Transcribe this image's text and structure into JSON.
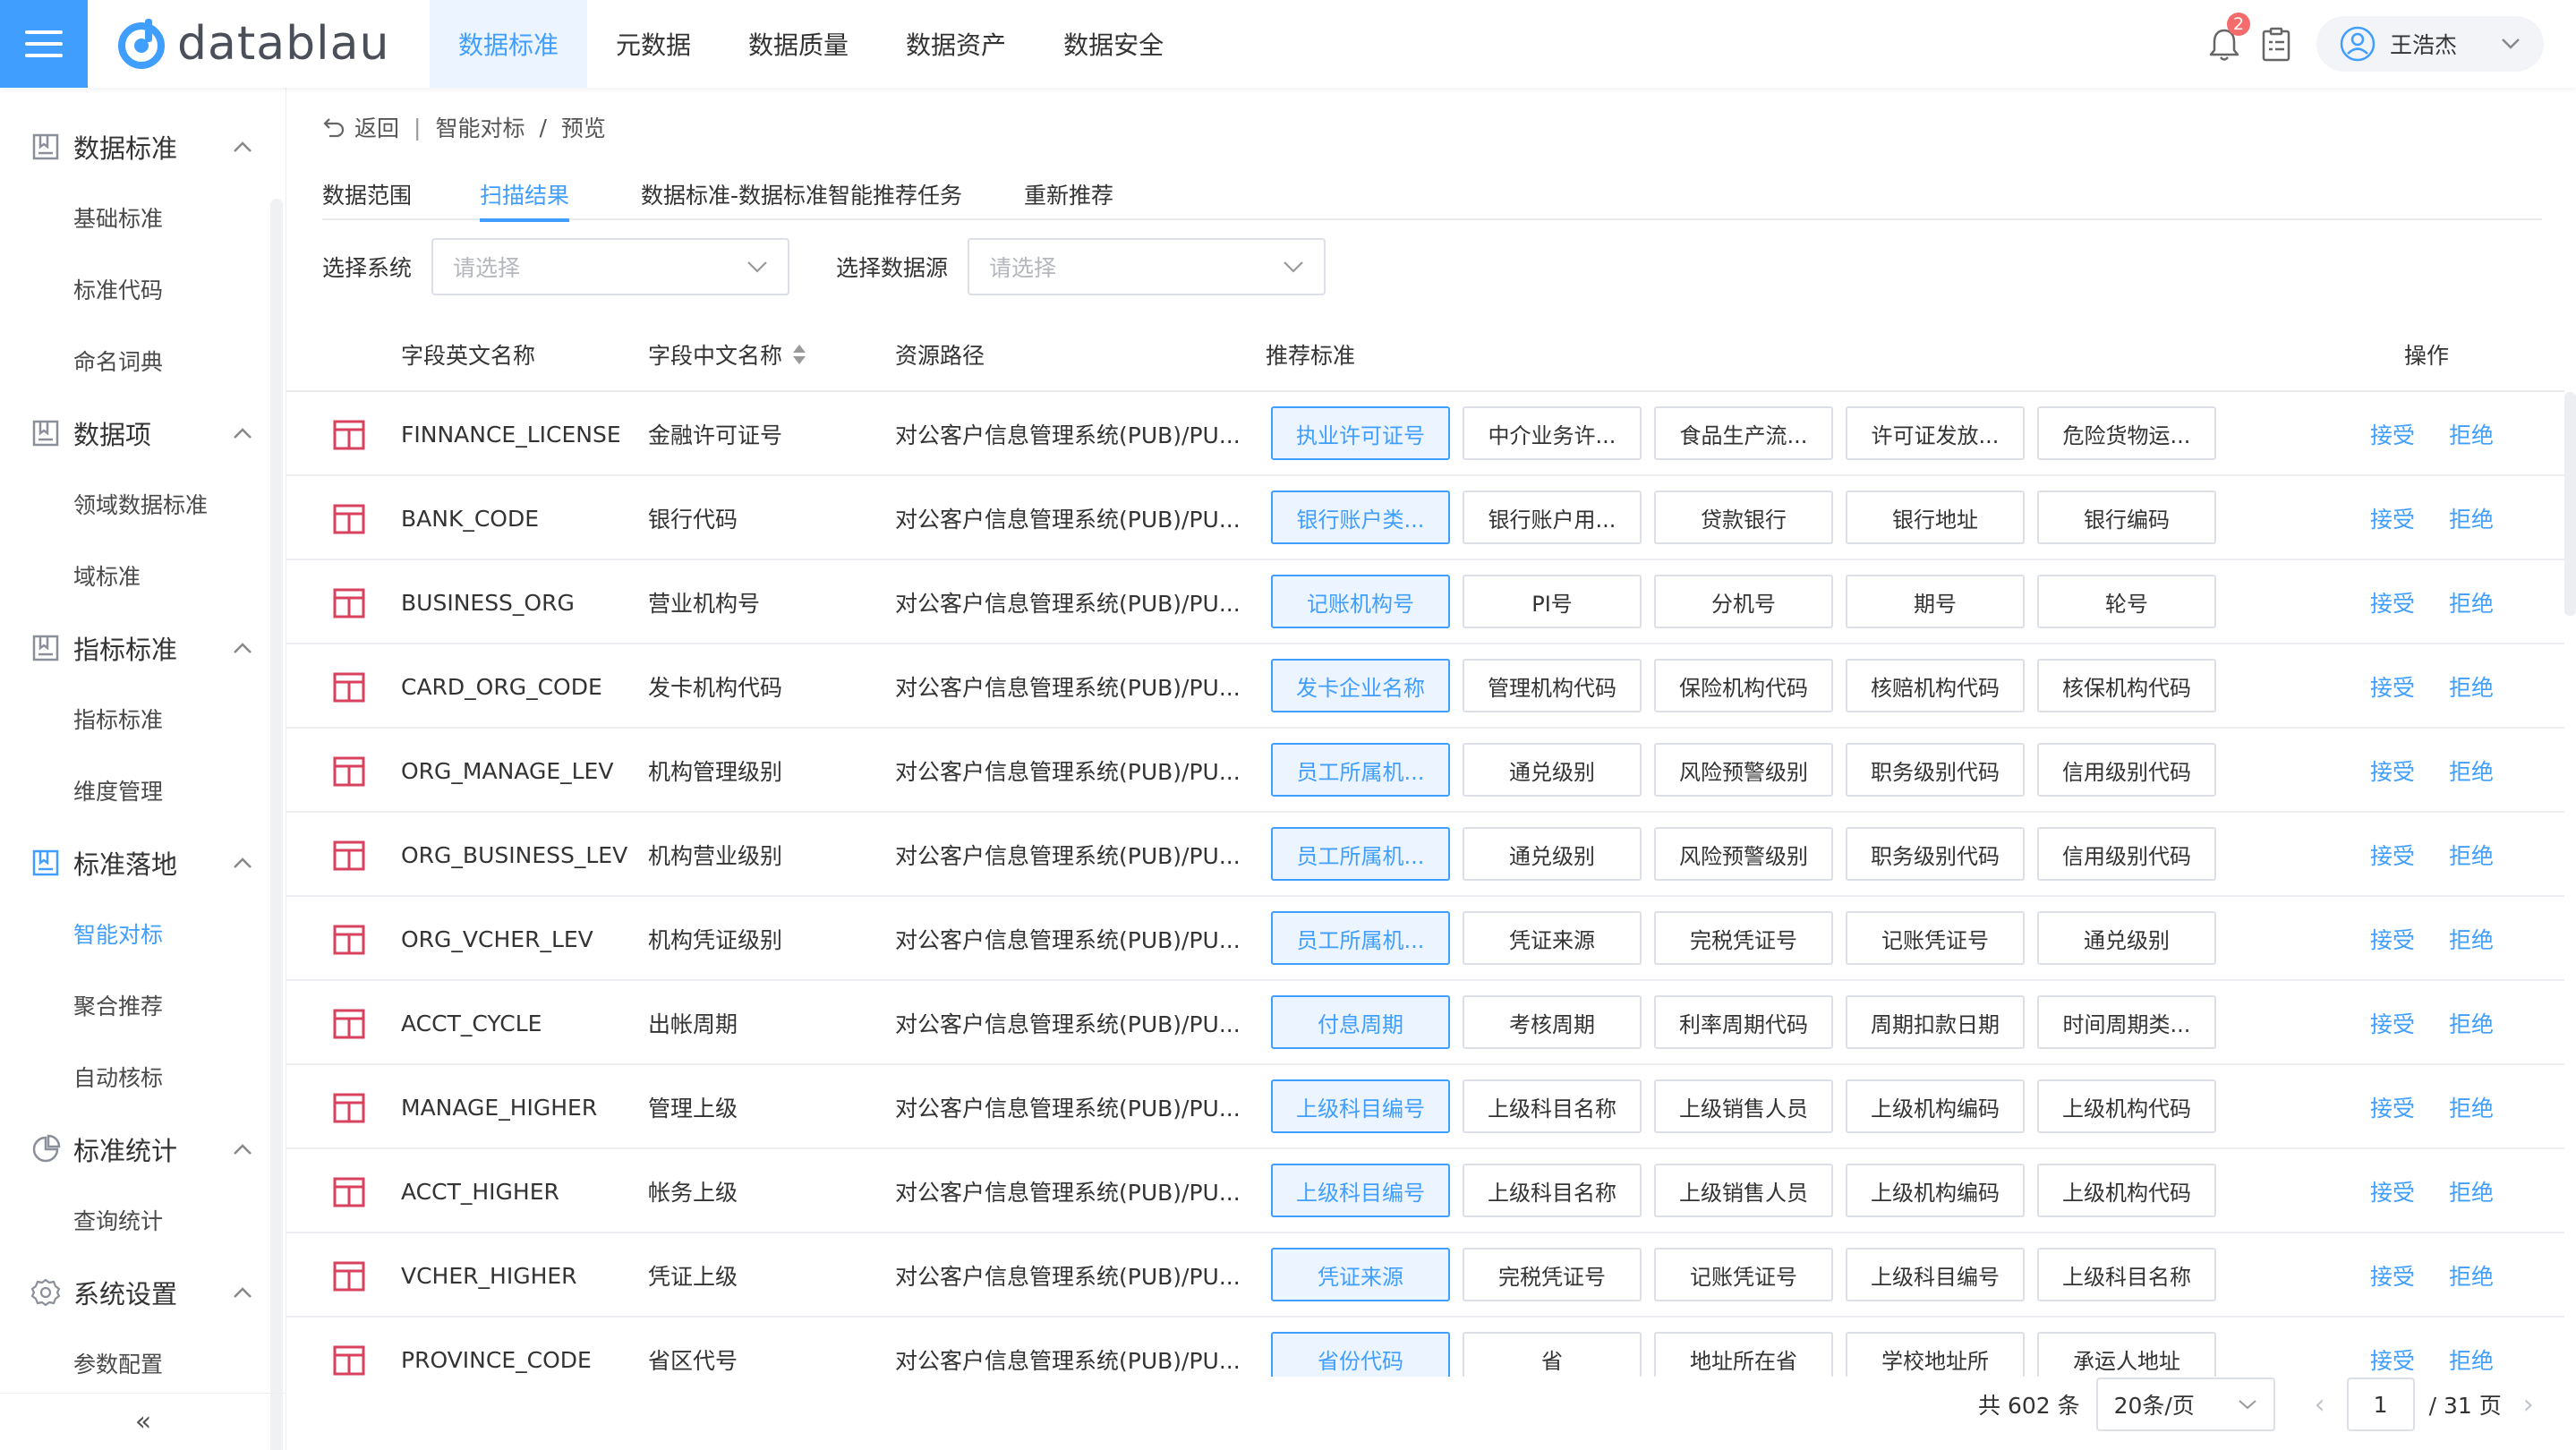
{
  "header": {
    "logo_text": "datablau",
    "nav": [
      "数据标准",
      "元数据",
      "数据质量",
      "数据资产",
      "数据安全"
    ],
    "notification_count": "2",
    "user_name": "王浩杰"
  },
  "sidebar": {
    "groups": [
      {
        "label": "数据标准",
        "icon": "book-icon",
        "items": [
          "基础标准",
          "标准代码",
          "命名词典"
        ]
      },
      {
        "label": "数据项",
        "icon": "book-icon",
        "items": [
          "领域数据标准",
          "域标准"
        ]
      },
      {
        "label": "指标标准",
        "icon": "book-icon",
        "items": [
          "指标标准",
          "维度管理"
        ]
      },
      {
        "label": "标准落地",
        "icon": "book-icon",
        "items": [
          "智能对标",
          "聚合推荐",
          "自动核标"
        ]
      },
      {
        "label": "标准统计",
        "icon": "chart-icon",
        "items": [
          "查询统计"
        ]
      },
      {
        "label": "系统设置",
        "icon": "gear-icon",
        "items": [
          "参数配置"
        ]
      }
    ],
    "active_item": "智能对标",
    "collapse_glyph": "«"
  },
  "breadcrumb": {
    "back": "返回",
    "sep1": "|",
    "path1": "智能对标",
    "sep2": "/",
    "path2": "预览"
  },
  "tabs": [
    "数据范围",
    "扫描结果",
    "数据标准-数据标准智能推荐任务",
    "重新推荐"
  ],
  "active_tab": "扫描结果",
  "filters": {
    "system_label": "选择系统",
    "system_placeholder": "请选择",
    "source_label": "选择数据源",
    "source_placeholder": "请选择"
  },
  "table": {
    "headers": {
      "en": "字段英文名称",
      "cn": "字段中文名称",
      "path": "资源路径",
      "rec": "推荐标准",
      "op": "操作"
    },
    "accept": "接受",
    "reject": "拒绝",
    "rows": [
      {
        "en": "FINNANCE_LICENSE",
        "cn": "金融许可证号",
        "path": "对公客户信息管理系统(PUB)/PU...",
        "recs": [
          "执业许可证号",
          "中介业务许...",
          "食品生产流...",
          "许可证发放...",
          "危险货物运..."
        ]
      },
      {
        "en": "BANK_CODE",
        "cn": "银行代码",
        "path": "对公客户信息管理系统(PUB)/PU...",
        "recs": [
          "银行账户类...",
          "银行账户用...",
          "贷款银行",
          "银行地址",
          "银行编码"
        ]
      },
      {
        "en": "BUSINESS_ORG",
        "cn": "营业机构号",
        "path": "对公客户信息管理系统(PUB)/PU...",
        "recs": [
          "记账机构号",
          "PI号",
          "分机号",
          "期号",
          "轮号"
        ]
      },
      {
        "en": "CARD_ORG_CODE",
        "cn": "发卡机构代码",
        "path": "对公客户信息管理系统(PUB)/PU...",
        "recs": [
          "发卡企业名称",
          "管理机构代码",
          "保险机构代码",
          "核赔机构代码",
          "核保机构代码"
        ]
      },
      {
        "en": "ORG_MANAGE_LEV",
        "cn": "机构管理级别",
        "path": "对公客户信息管理系统(PUB)/PU...",
        "recs": [
          "员工所属机...",
          "通兑级别",
          "风险预警级别",
          "职务级别代码",
          "信用级别代码"
        ]
      },
      {
        "en": "ORG_BUSINESS_LEV",
        "cn": "机构营业级别",
        "path": "对公客户信息管理系统(PUB)/PU...",
        "recs": [
          "员工所属机...",
          "通兑级别",
          "风险预警级别",
          "职务级别代码",
          "信用级别代码"
        ]
      },
      {
        "en": "ORG_VCHER_LEV",
        "cn": "机构凭证级别",
        "path": "对公客户信息管理系统(PUB)/PU...",
        "recs": [
          "员工所属机...",
          "凭证来源",
          "完税凭证号",
          "记账凭证号",
          "通兑级别"
        ]
      },
      {
        "en": "ACCT_CYCLE",
        "cn": "出帐周期",
        "path": "对公客户信息管理系统(PUB)/PU...",
        "recs": [
          "付息周期",
          "考核周期",
          "利率周期代码",
          "周期扣款日期",
          "时间周期类..."
        ]
      },
      {
        "en": "MANAGE_HIGHER",
        "cn": "管理上级",
        "path": "对公客户信息管理系统(PUB)/PU...",
        "recs": [
          "上级科目编号",
          "上级科目名称",
          "上级销售人员",
          "上级机构编码",
          "上级机构代码"
        ]
      },
      {
        "en": "ACCT_HIGHER",
        "cn": "帐务上级",
        "path": "对公客户信息管理系统(PUB)/PU...",
        "recs": [
          "上级科目编号",
          "上级科目名称",
          "上级销售人员",
          "上级机构编码",
          "上级机构代码"
        ]
      },
      {
        "en": "VCHER_HIGHER",
        "cn": "凭证上级",
        "path": "对公客户信息管理系统(PUB)/PU...",
        "recs": [
          "凭证来源",
          "完税凭证号",
          "记账凭证号",
          "上级科目编号",
          "上级科目名称"
        ]
      },
      {
        "en": "PROVINCE_CODE",
        "cn": "省区代号",
        "path": "对公客户信息管理系统(PUB)/PU...",
        "recs": [
          "省份代码",
          "省",
          "地址所在省",
          "学校地址所",
          "承运人地址"
        ]
      }
    ]
  },
  "pagination": {
    "total": "共 602 条",
    "page_size": "20条/页",
    "prev": "‹",
    "current": "1",
    "pages": "/ 31 页",
    "next": "›"
  },
  "colors": {
    "primary": "#409eff",
    "primary_light": "#ecf5ff",
    "badge": "#f56c6c"
  }
}
